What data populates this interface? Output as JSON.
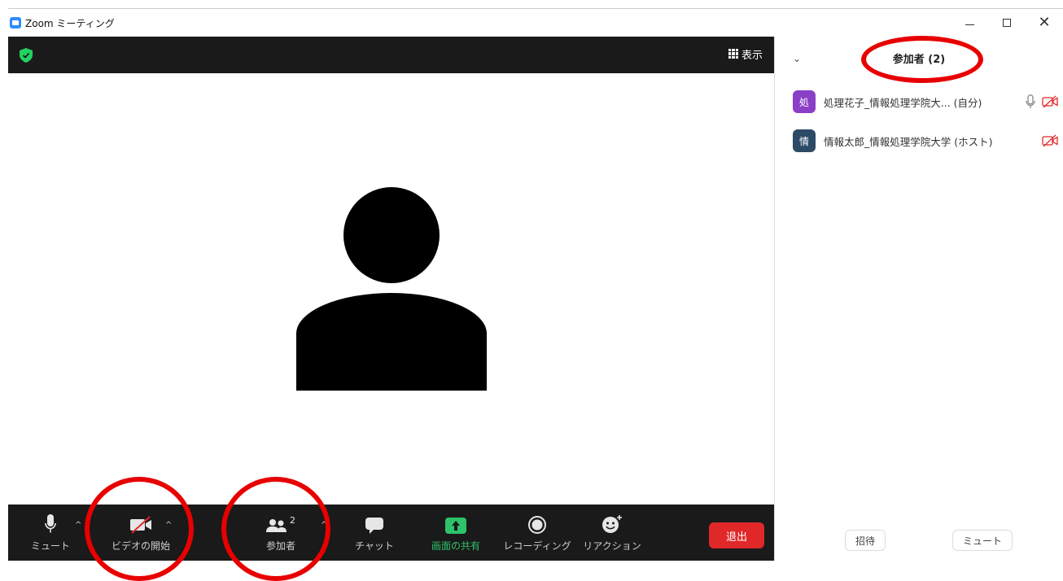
{
  "window": {
    "title": "Zoom ミーティング"
  },
  "video": {
    "view_label": "表示"
  },
  "toolbar": {
    "mute_label": "ミュート",
    "video_label": "ビデオの開始",
    "participants_label": "参加者",
    "participants_count": "2",
    "chat_label": "チャット",
    "share_label": "画面の共有",
    "record_label": "レコーディング",
    "reaction_label": "リアクション",
    "leave_label": "退出"
  },
  "panel": {
    "title": "参加者 (2)",
    "participants": [
      {
        "initial": "処",
        "name": "処理花子_情報処理学院大... (自分)",
        "avatar_color": "#8a3fc7"
      },
      {
        "initial": "情",
        "name": "情報太郎_情報処理学院大学 (ホスト)",
        "avatar_color": "#2c4a66"
      }
    ],
    "invite_label": "招待",
    "mute_all_label": "ミュート"
  },
  "colors": {
    "toolbar_bg": "#1a1a1a",
    "leave_red": "#e02828",
    "share_green": "#2ec26a",
    "annotation_red": "#e80000",
    "accent_blue": "#2d8cff"
  }
}
